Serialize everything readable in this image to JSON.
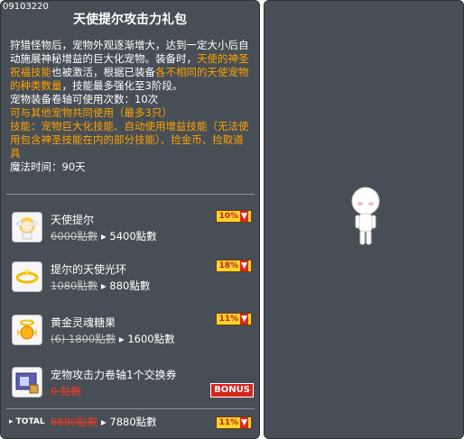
{
  "code": "09103220",
  "title": "天使提尔攻击力礼包",
  "desc": {
    "line1a": "狩猎怪物后，宠物外观逐渐增大，达到一定大小后自动施展神秘增益的巨大化宠物。装备时，",
    "line1b": "天使的神圣祝福技能",
    "line1c": "也被激活，根据已装备",
    "line1d": "各不相同的天使宠物的种类数量",
    "line1e": "，技能最多强化至3阶段。",
    "line2": "宠物装备卷轴可使用次数：10次",
    "line3": "可与其他宠物共同使用（最多3只）",
    "line4": "技能：宠物巨大化技能、自动使用增益技能（无法使用包含神圣技能在内的部分技能）、捡金币、捡取道具",
    "line5": "魔法时间：90天"
  },
  "items": [
    {
      "name": "天使提尔",
      "old_price": "6000點數",
      "arrow": "▸",
      "new_price": "5400點數",
      "badge": "10%",
      "icon": "angel-tyr-icon"
    },
    {
      "name": "提尔的天使光环",
      "old_price": "1080點數",
      "arrow": "▸",
      "new_price": "880點數",
      "badge": "18%",
      "icon": "halo-icon"
    },
    {
      "name": "黄金灵魂糖果",
      "old_price": "(6) 1800點數",
      "arrow": "▸",
      "new_price": "1600點數",
      "badge": "11%",
      "icon": "golden-candy-icon"
    },
    {
      "name": "宠物攻击力卷轴1个交换券",
      "old_price": "0 點數",
      "arrow": "",
      "new_price": "",
      "badge": "BONUS",
      "icon": "scroll-coupon-icon"
    }
  ],
  "total": {
    "label": "TOTAL",
    "old_price": "8880點數",
    "new_price": "7880點數",
    "badge": "11%"
  }
}
